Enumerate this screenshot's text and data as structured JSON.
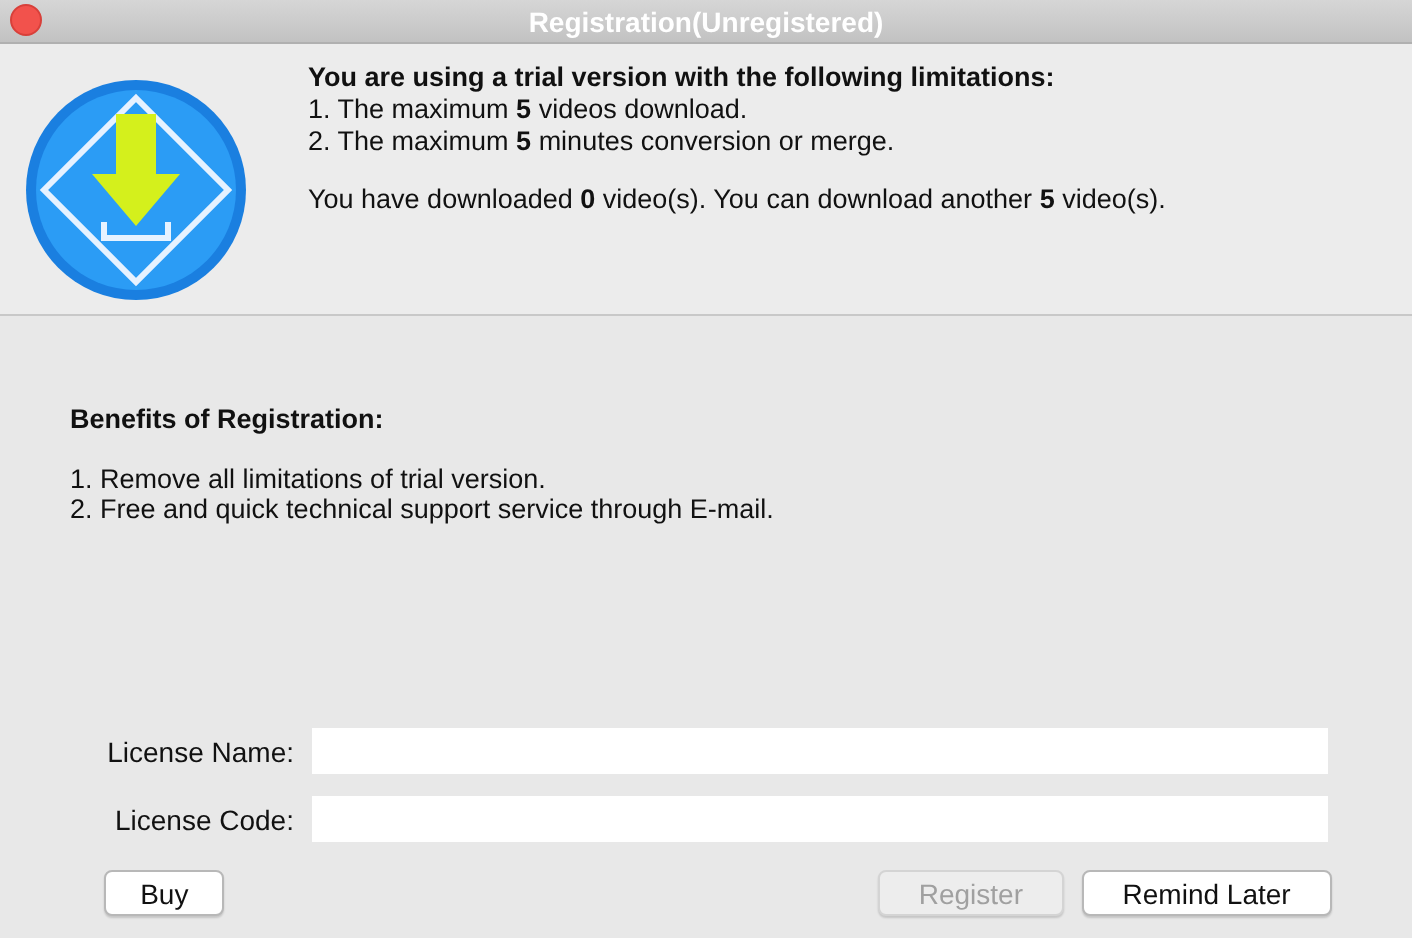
{
  "window": {
    "title": "Registration(Unregistered)"
  },
  "trial_notice": {
    "heading": "You are using a trial version with the following limitations:",
    "limitations": [
      "1. The maximum **5** videos download.",
      "2. The maximum **5** minutes conversion or merge."
    ],
    "download_status": "You have downloaded **0** video(s). You can download another **5** video(s)."
  },
  "benefits": {
    "heading": "Benefits of Registration:",
    "items": [
      "1. Remove all limitations of trial version.",
      "2. Free and quick technical support service through E-mail."
    ]
  },
  "fields": [
    {
      "label": "License Name:"
    },
    {
      "label": "License Code:"
    }
  ],
  "buttons": [
    {
      "label": "Buy",
      "disabled": false
    },
    {
      "label": "Register",
      "disabled": true
    },
    {
      "label": "Remind Later",
      "disabled": false
    }
  ]
}
